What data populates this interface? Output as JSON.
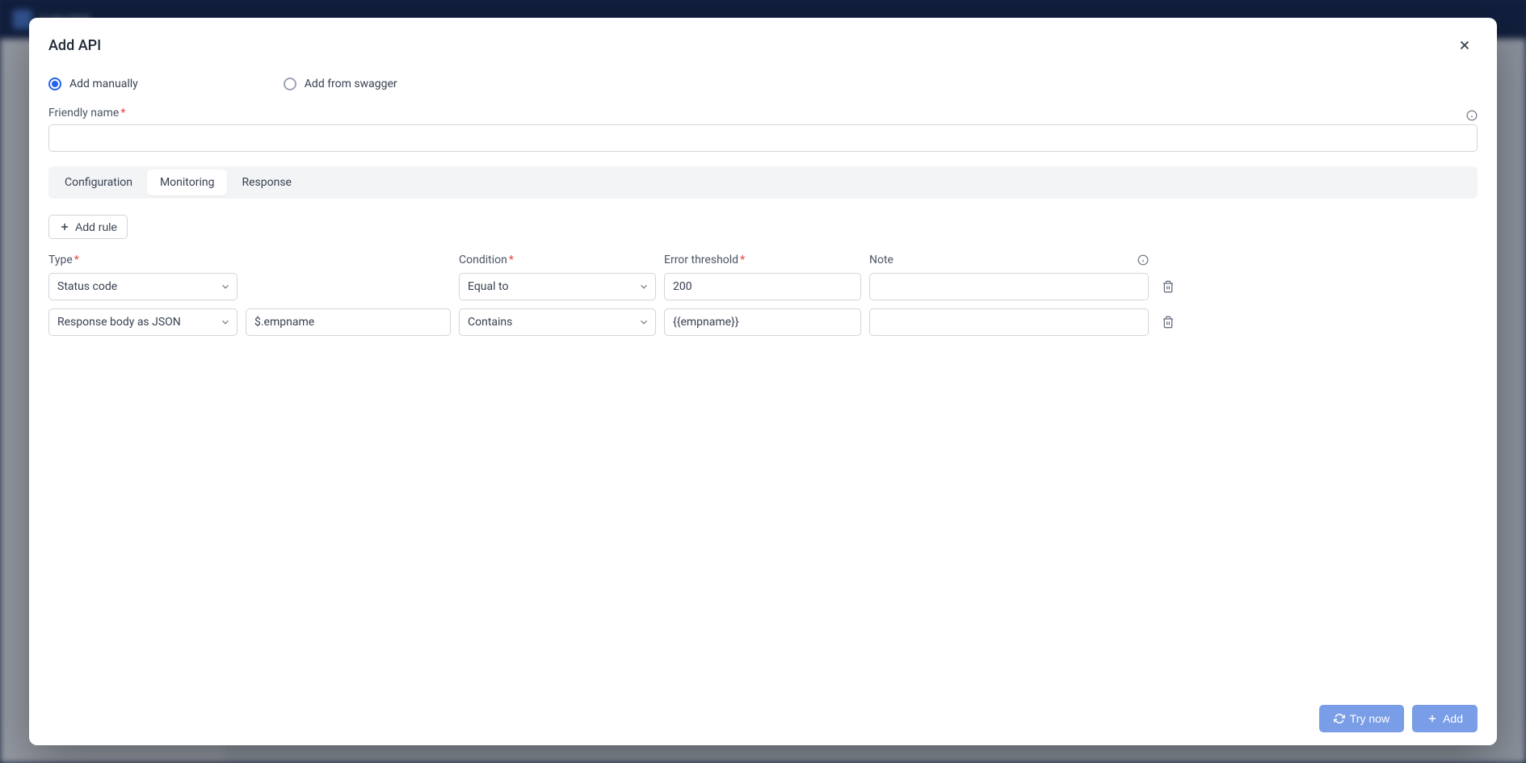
{
  "backdrop": {
    "product": "turbo360"
  },
  "modal": {
    "title": "Add API",
    "radios": {
      "manual": "Add manually",
      "swagger": "Add from swagger"
    },
    "friendly_name_label": "Friendly name",
    "friendly_name_value": "",
    "tabs": {
      "configuration": "Configuration",
      "monitoring": "Monitoring",
      "response": "Response"
    },
    "add_rule": "Add rule",
    "columns": {
      "type": "Type",
      "condition": "Condition",
      "error_threshold": "Error threshold",
      "note": "Note"
    },
    "rules": [
      {
        "type": "Status code",
        "path": "",
        "condition": "Equal to",
        "threshold": "200",
        "note": ""
      },
      {
        "type": "Response body as JSON",
        "path": "$.empname",
        "condition": "Contains",
        "threshold": "{{empname}}",
        "note": ""
      }
    ],
    "footer": {
      "try_now": "Try now",
      "add": "Add"
    }
  }
}
